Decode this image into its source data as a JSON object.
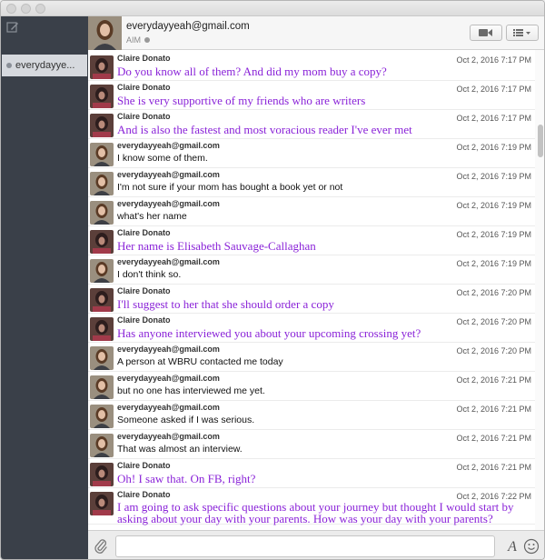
{
  "sidebar": {
    "conversation": "everydayye..."
  },
  "header": {
    "name": "everydayyeah@gmail.com",
    "service": "AIM"
  },
  "messages": [
    {
      "sender": "Claire Donato",
      "time": "Oct 2, 2016 7:17 PM",
      "text": "Do you know all of them? And did my mom buy a copy?",
      "who": "claire"
    },
    {
      "sender": "Claire Donato",
      "time": "Oct 2, 2016 7:17 PM",
      "text": "She is very supportive of my friends who are writers",
      "who": "claire"
    },
    {
      "sender": "Claire Donato",
      "time": "Oct 2, 2016 7:17 PM",
      "text": "And is also the fastest and most voracious reader I've ever met",
      "who": "claire"
    },
    {
      "sender": "everydayyeah@gmail.com",
      "time": "Oct 2, 2016 7:19 PM",
      "text": "I know some of them.",
      "who": "me"
    },
    {
      "sender": "everydayyeah@gmail.com",
      "time": "Oct 2, 2016 7:19 PM",
      "text": "I'm not sure if your mom has bought a book yet or not",
      "who": "me"
    },
    {
      "sender": "everydayyeah@gmail.com",
      "time": "Oct 2, 2016 7:19 PM",
      "text": "what's her name",
      "who": "me"
    },
    {
      "sender": "Claire Donato",
      "time": "Oct 2, 2016 7:19 PM",
      "text": "Her name is Elisabeth Sauvage-Callaghan",
      "who": "claire"
    },
    {
      "sender": "everydayyeah@gmail.com",
      "time": "Oct 2, 2016 7:19 PM",
      "text": "I don't think so.",
      "who": "me"
    },
    {
      "sender": "Claire Donato",
      "time": "Oct 2, 2016 7:20 PM",
      "text": "I'll suggest to her that she should order a copy",
      "who": "claire"
    },
    {
      "sender": "Claire Donato",
      "time": "Oct 2, 2016 7:20 PM",
      "text": "Has anyone interviewed you about your upcoming crossing yet?",
      "who": "claire"
    },
    {
      "sender": "everydayyeah@gmail.com",
      "time": "Oct 2, 2016 7:20 PM",
      "text": "A person at WBRU contacted me today",
      "who": "me"
    },
    {
      "sender": "everydayyeah@gmail.com",
      "time": "Oct 2, 2016 7:21 PM",
      "text": "but no one has interviewed me yet.",
      "who": "me"
    },
    {
      "sender": "everydayyeah@gmail.com",
      "time": "Oct 2, 2016 7:21 PM",
      "text": "Someone asked if I was serious.",
      "who": "me"
    },
    {
      "sender": "everydayyeah@gmail.com",
      "time": "Oct 2, 2016 7:21 PM",
      "text": "That was almost an interview.",
      "who": "me"
    },
    {
      "sender": "Claire Donato",
      "time": "Oct 2, 2016 7:21 PM",
      "text": "Oh! I saw that. On FB, right?",
      "who": "claire"
    },
    {
      "sender": "Claire Donato",
      "time": "Oct 2, 2016 7:22 PM",
      "text": "I am going to ask specific questions about your journey but thought I would start by asking about your day with your parents. How was your day with your parents?",
      "who": "claire"
    }
  ],
  "input": {
    "value": ""
  },
  "colors": {
    "claire_text": "#8a23d8",
    "sidebar_bg": "#3a4049"
  }
}
